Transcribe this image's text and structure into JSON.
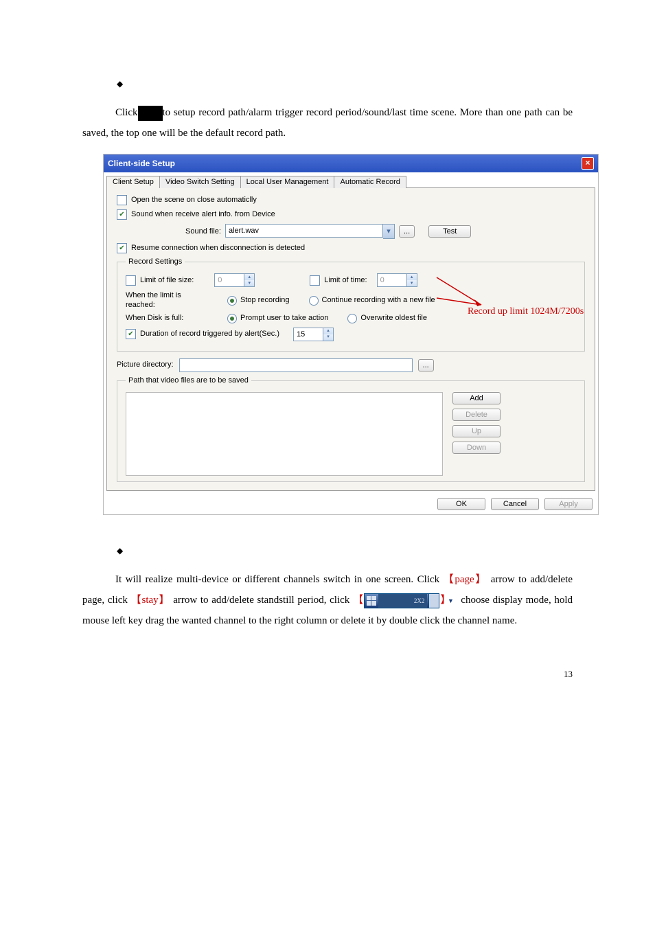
{
  "body": {
    "para1a": "Click",
    "para1b": "to setup record path/alarm trigger record period/sound/last time scene. More than one path can be saved, the top one will be the default record path.",
    "para2a": "It will realize multi-device or different channels switch in one screen. Click",
    "para2b": "arrow to add/delete page, click",
    "para2c": "arrow to add/delete standstill period, click",
    "para2d": "choose display mode, hold mouse left key drag the wanted channel to the right column or delete it by double click the channel name.",
    "page_word": "page",
    "stay_word": "stay",
    "lbrak": "【",
    "rbrak": "】",
    "mode_label": "2X2"
  },
  "dialog": {
    "title": "Client-side Setup",
    "tabs": [
      "Client Setup",
      "Video Switch Setting",
      "Local User Management",
      "Automatic Record"
    ],
    "open_scene": "Open the scene on close automaticlly",
    "sound_when": "Sound when receive alert info. from Device",
    "sound_file_label": "Sound file:",
    "sound_file_value": "alert.wav",
    "test_btn": "Test",
    "resume_conn": "Resume connection when disconnection is detected",
    "record_legend": "Record Settings",
    "limit_file_size": "Limit of file size:",
    "limit_file_val": "0",
    "limit_time": "Limit of time:",
    "limit_time_val": "0",
    "when_limit": "When the limit is reached:",
    "stop_rec": "Stop recording",
    "cont_rec": "Continue recording with a new file",
    "when_disk": "When Disk is full:",
    "prompt_user": "Prompt user to take action",
    "overwrite": "Overwrite oldest file",
    "duration_label": "Duration of record triggered by alert(Sec.)",
    "duration_val": "15",
    "pic_dir": "Picture directory:",
    "path_legend": "Path that video files are to be saved",
    "add": "Add",
    "delete": "Delete",
    "up": "Up",
    "down": "Down",
    "ok": "OK",
    "cancel": "Cancel",
    "apply": "Apply",
    "callout": "Record up limit 1024M/7200s",
    "browse": "..."
  },
  "page_number": "13"
}
